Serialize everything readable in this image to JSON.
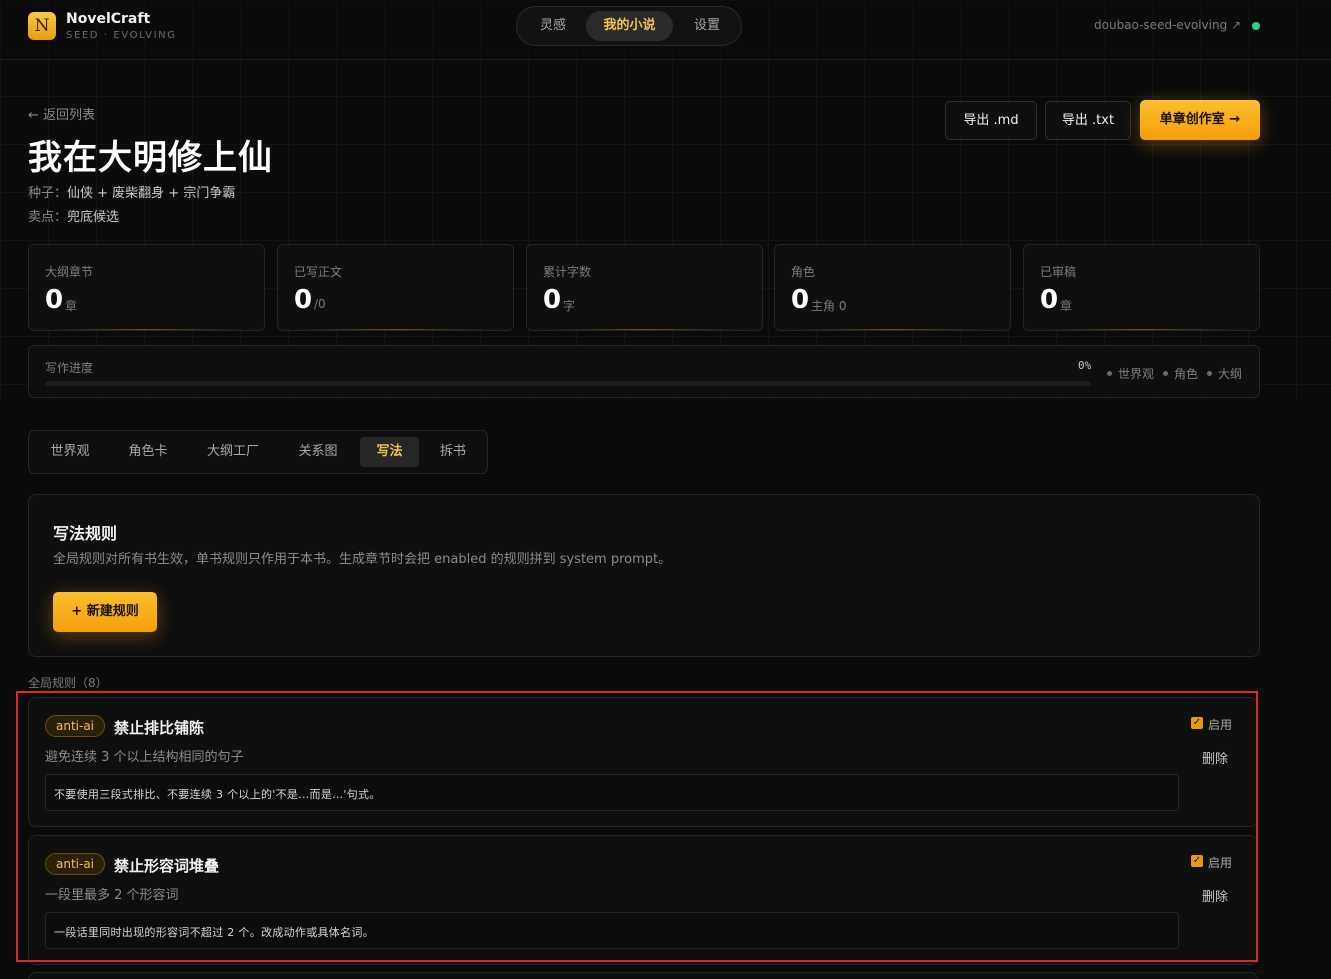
{
  "app": {
    "logo_letter": "N",
    "name": "NovelCraft",
    "subtitle": "SEED · EVOLVING",
    "model_link": "doubao-seed-evolving ↗",
    "status_color": "#2fd08a"
  },
  "nav": {
    "items": [
      {
        "label": "灵感",
        "active": false
      },
      {
        "label": "我的小说",
        "active": true
      },
      {
        "label": "设置",
        "active": false
      }
    ]
  },
  "novel": {
    "back_label": "← 返回列表",
    "title": "我在大明修上仙",
    "seed_label": "种子：",
    "seed_value": "仙侠 + 废柴翻身 + 宗门争霸",
    "selling_label": "卖点：",
    "selling_value": "兜底候选"
  },
  "actions": {
    "export_md": "导出 .md",
    "export_txt": "导出 .txt",
    "studio": "单章创作室 →"
  },
  "stats": [
    {
      "label": "大纲章节",
      "value": "0",
      "unit": "章"
    },
    {
      "label": "已写正文",
      "value": "0",
      "unit": "/0"
    },
    {
      "label": "累计字数",
      "value": "0",
      "unit": "字"
    },
    {
      "label": "角色",
      "value": "0",
      "unit": "主角 0"
    },
    {
      "label": "已审稿",
      "value": "0",
      "unit": "章"
    }
  ],
  "progress": {
    "label": "写作进度",
    "percent_text": "0%",
    "percent": 0,
    "legend": [
      "世界观",
      "角色",
      "大纲"
    ]
  },
  "tabs": [
    {
      "label": "世界观",
      "active": false
    },
    {
      "label": "角色卡",
      "active": false
    },
    {
      "label": "大纲工厂",
      "active": false
    },
    {
      "label": "关系图",
      "active": false
    },
    {
      "label": "写法",
      "active": true
    },
    {
      "label": "拆书",
      "active": false
    }
  ],
  "rules_panel": {
    "title": "写法规则",
    "description": "全局规则对所有书生效，单书规则只作用于本书。生成章节时会把 enabled 的规则拼到 system prompt。",
    "new_button": "+ 新建规则"
  },
  "global_rules": {
    "section_label": "全局规则（8）",
    "enable_label": "启用",
    "delete_label": "删除",
    "items": [
      {
        "tag": "anti-ai",
        "title": "禁止排比铺陈",
        "summary": "避免连续 3 个以上结构相同的句子",
        "content": "不要使用三段式排比、不要连续 3 个以上的'不是…而是…'句式。",
        "enabled": true
      },
      {
        "tag": "anti-ai",
        "title": "禁止形容词堆叠",
        "summary": "一段里最多 2 个形容词",
        "content": "一段话里同时出现的形容词不超过 2 个。改成动作或具体名词。",
        "enabled": true
      }
    ]
  },
  "colors": {
    "accent": "#f59e0b",
    "accent_text": "#f3c150",
    "highlight": "#e0262b",
    "background": "#0b0b0c"
  }
}
